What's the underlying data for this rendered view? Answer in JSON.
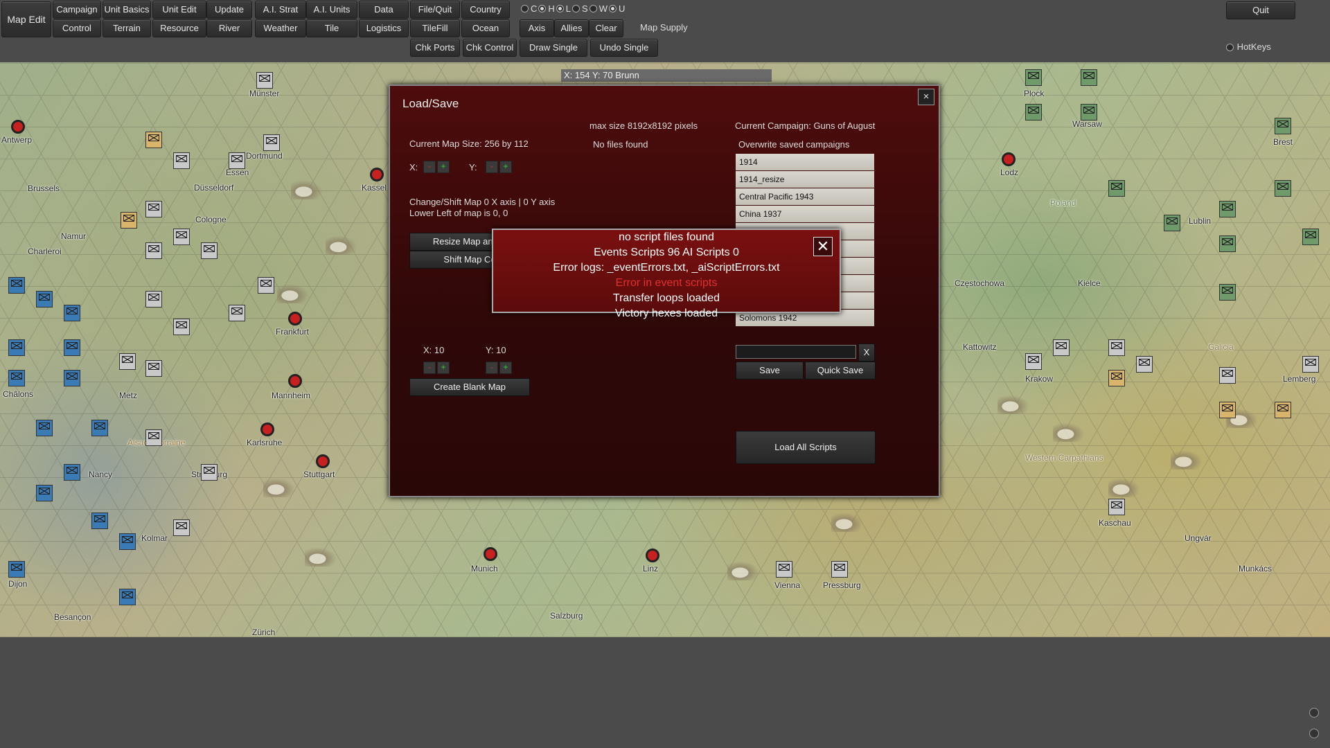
{
  "toolbar": {
    "map_edit": "Map Edit",
    "row1": [
      "Campaign",
      "Unit Basics",
      "Unit Edit",
      "Update",
      "A.I. Strat",
      "A.I. Units",
      "Data",
      "File/Quit",
      "Country"
    ],
    "row2": [
      "Control",
      "Terrain",
      "Resource",
      "River",
      "Weather",
      "Tile",
      "Logistics",
      "TileFill",
      "Ocean"
    ],
    "row3": [
      "Chk Ports",
      "Chk Control",
      "Draw Single",
      "Undo Single"
    ],
    "side": [
      "Axis",
      "Allies",
      "Clear"
    ],
    "radio_labels": [
      "C",
      "H",
      "L",
      "S",
      "W",
      "U"
    ],
    "map_supply": "Map Supply",
    "quit": "Quit",
    "hotkeys": "HotKeys"
  },
  "coord_readout": "X: 154 Y: 70 Brunn",
  "dialog": {
    "title": "Load/Save",
    "close": "×",
    "current_map_size": "Current Map Size: 256 by 112",
    "max_size": "max size 8192x8192 pixels",
    "no_files": "No files found",
    "current_campaign": "Current Campaign: Guns of August",
    "overwrite": "Overwrite saved campaigns",
    "x_label": "X:",
    "y_label": "Y:",
    "minus": "-",
    "plus": "+",
    "shift_info1": "Change/Shift Map 0 X axis | 0 Y axis",
    "shift_info2": "Lower Left of map is 0, 0",
    "resize_btn": "Resize Map and S",
    "shift_btn": "Shift Map Co",
    "x10": "X: 10",
    "y10": "Y: 10",
    "create_blank": "Create Blank Map",
    "campaigns": [
      "1914",
      "1914_resize",
      "Central Pacific 1943",
      "China 1937",
      "",
      "",
      "",
      "",
      "",
      "Solomons 1942"
    ],
    "clear_x": "X",
    "save": "Save",
    "quick_save": "Quick Save",
    "load_all": "Load All Scripts"
  },
  "error_popup": {
    "line1": "no script files found",
    "line2": "Events Scripts 96     AI Scripts 0",
    "line3": "Error logs: _eventErrors.txt, _aiScriptErrors.txt",
    "line4": "Error in event scripts",
    "line5": "Transfer loops loaded",
    "line6": "Victory hexes loaded",
    "close": "✕"
  },
  "map": {
    "cities": [
      "Antwerp",
      "Brussels",
      "Namur",
      "Charleroi",
      "Châlons",
      "Metz",
      "Nancy",
      "Dijon",
      "Besançon",
      "Münster",
      "Dortmund",
      "Essen",
      "Düsseldorf",
      "Cologne",
      "Frankfurt",
      "Mannheim",
      "Karlsruhe",
      "Stuttgart",
      "Strasburg",
      "Kolmar",
      "Zürich",
      "Munich",
      "Salzburg",
      "Linz",
      "Vienna",
      "Pressburg",
      "Plock",
      "Warsaw",
      "Brest",
      "Lodz",
      "Lublin",
      "Częstochowa",
      "Kielce",
      "Kattowitz",
      "Krakow",
      "Kaschau",
      "Ungvár",
      "Munkács",
      "Lemberg",
      "Kassel"
    ],
    "regions": [
      "Poland",
      "Galicia",
      "Western Carpathians",
      "Alsace Lorraine"
    ]
  },
  "colors": {
    "dialog_bg": "#4e0c0c",
    "error_bg": "#7a1010",
    "error_text": "#e03030",
    "toolbar_bg": "#4b4b4b"
  }
}
